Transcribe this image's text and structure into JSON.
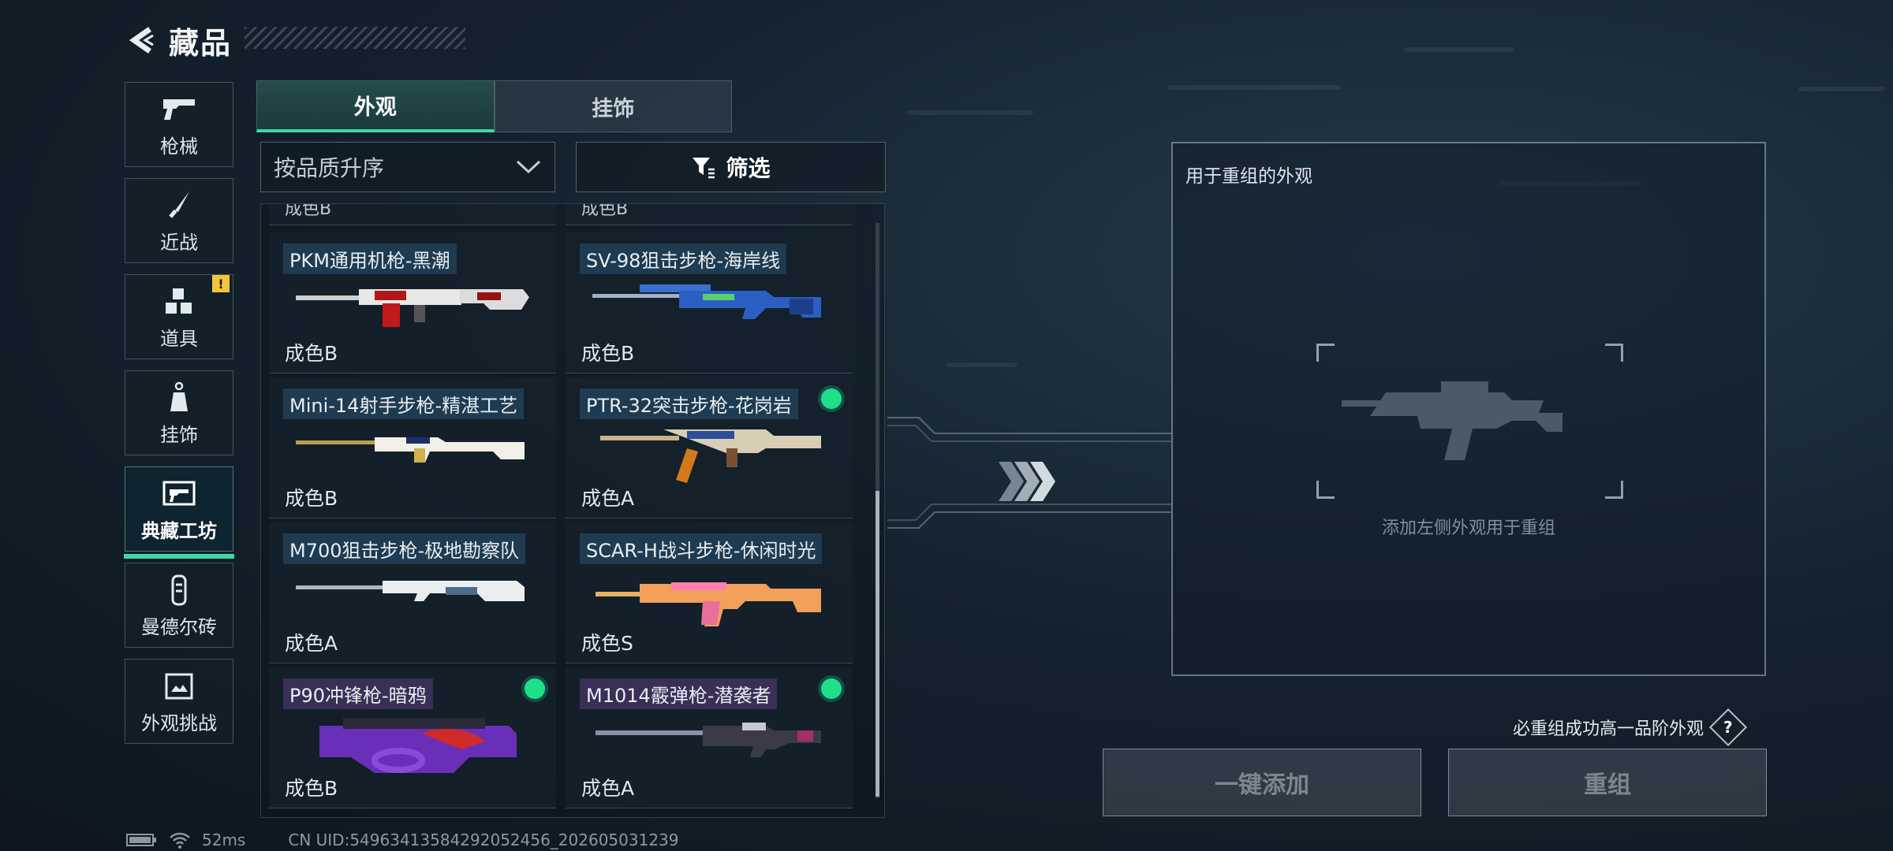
{
  "header": {
    "title": "藏品"
  },
  "sidebar": {
    "items": [
      {
        "label": "枪械"
      },
      {
        "label": "近战"
      },
      {
        "label": "道具",
        "badge": "!"
      },
      {
        "label": "挂饰"
      },
      {
        "label": "典藏工坊",
        "active": true
      },
      {
        "label": "曼德尔砖"
      },
      {
        "label": "外观挑战"
      }
    ]
  },
  "tabs": [
    {
      "label": "外观",
      "active": true
    },
    {
      "label": "挂饰"
    }
  ],
  "sort": {
    "label": "按品质升序"
  },
  "filter": {
    "label": "筛选"
  },
  "list": {
    "partial_top": [
      "成色B",
      "成色B"
    ],
    "items": [
      {
        "name": "PKM通用机枪-黑潮",
        "grade": "成色B",
        "owned_dot": false
      },
      {
        "name": "SV-98狙击步枪-海岸线",
        "grade": "成色B",
        "owned_dot": false
      },
      {
        "name": "Mini-14射手步枪-精湛工艺",
        "grade": "成色B",
        "owned_dot": false
      },
      {
        "name": "PTR-32突击步枪-花岗岩",
        "grade": "成色A",
        "owned_dot": true
      },
      {
        "name": "M700狙击步枪-极地勘察队",
        "grade": "成色A",
        "owned_dot": false
      },
      {
        "name": "SCAR-H战斗步枪-休闲时光",
        "grade": "成色S",
        "owned_dot": false
      },
      {
        "name": "P90冲锋枪-暗鸦",
        "grade": "成色B",
        "owned_dot": true
      },
      {
        "name": "M1014霰弹枪-潜袭者",
        "grade": "成色A",
        "owned_dot": true
      }
    ]
  },
  "panel": {
    "title": "用于重组的外观",
    "hint": "添加左侧外观用于重组"
  },
  "note": {
    "text": "必重组成功高一品阶外观",
    "help": "?"
  },
  "actions": {
    "add_all": "一键添加",
    "recombine": "重组"
  },
  "footer": {
    "ping": "52ms",
    "uid": "CN UID:5496341358429205245​6_202605031239"
  },
  "colors": {
    "accent": "#3fd8a5",
    "owned_dot": "#1ee08a",
    "warn": "#f0c73a"
  }
}
